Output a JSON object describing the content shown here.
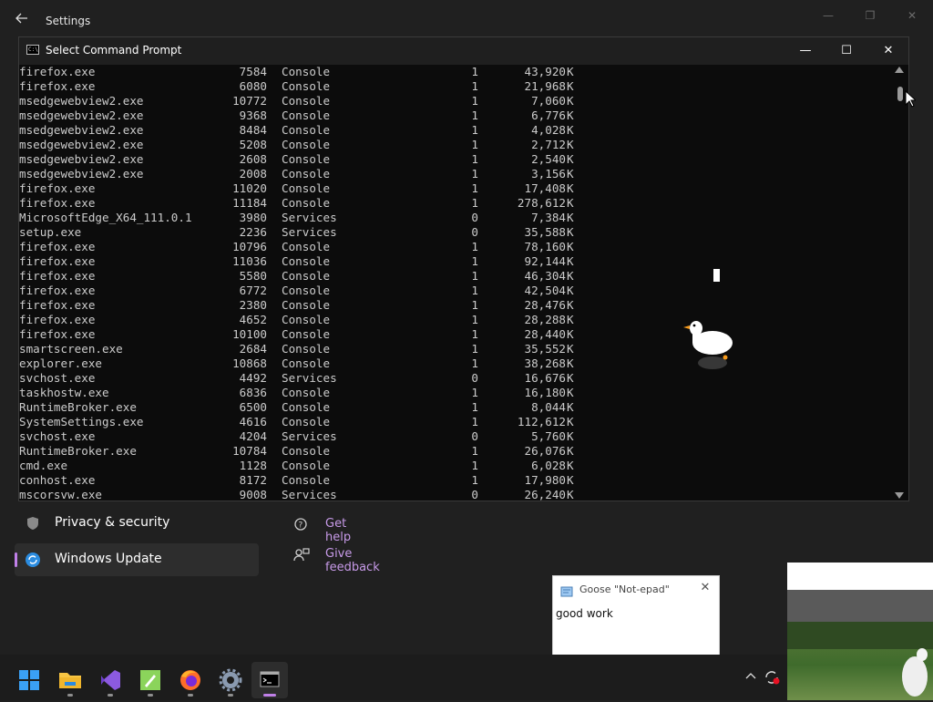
{
  "settings": {
    "title": "Settings",
    "sidebar": [
      {
        "label": "Privacy & security",
        "icon": "shield-icon"
      },
      {
        "label": "Windows Update",
        "icon": "windows-update-icon",
        "active": true
      }
    ],
    "links": [
      {
        "label": "Get help",
        "icon": "help-icon"
      },
      {
        "label": "Give feedback",
        "icon": "feedback-icon"
      }
    ]
  },
  "cmd": {
    "title": "Select Command Prompt",
    "rows": [
      {
        "name": "firefox.exe",
        "pid": "7584",
        "session": "Console",
        "num": "1",
        "mem": "43,920",
        "unit": "K"
      },
      {
        "name": "firefox.exe",
        "pid": "6080",
        "session": "Console",
        "num": "1",
        "mem": "21,968",
        "unit": "K"
      },
      {
        "name": "msedgewebview2.exe",
        "pid": "10772",
        "session": "Console",
        "num": "1",
        "mem": "7,060",
        "unit": "K"
      },
      {
        "name": "msedgewebview2.exe",
        "pid": "9368",
        "session": "Console",
        "num": "1",
        "mem": "6,776",
        "unit": "K"
      },
      {
        "name": "msedgewebview2.exe",
        "pid": "8484",
        "session": "Console",
        "num": "1",
        "mem": "4,028",
        "unit": "K"
      },
      {
        "name": "msedgewebview2.exe",
        "pid": "5208",
        "session": "Console",
        "num": "1",
        "mem": "2,712",
        "unit": "K"
      },
      {
        "name": "msedgewebview2.exe",
        "pid": "2608",
        "session": "Console",
        "num": "1",
        "mem": "2,540",
        "unit": "K"
      },
      {
        "name": "msedgewebview2.exe",
        "pid": "2008",
        "session": "Console",
        "num": "1",
        "mem": "3,156",
        "unit": "K"
      },
      {
        "name": "firefox.exe",
        "pid": "11020",
        "session": "Console",
        "num": "1",
        "mem": "17,408",
        "unit": "K"
      },
      {
        "name": "firefox.exe",
        "pid": "11184",
        "session": "Console",
        "num": "1",
        "mem": "278,612",
        "unit": "K"
      },
      {
        "name": "MicrosoftEdge_X64_111.0.1",
        "pid": "3980",
        "session": "Services",
        "num": "0",
        "mem": "7,384",
        "unit": "K"
      },
      {
        "name": "setup.exe",
        "pid": "2236",
        "session": "Services",
        "num": "0",
        "mem": "35,588",
        "unit": "K"
      },
      {
        "name": "firefox.exe",
        "pid": "10796",
        "session": "Console",
        "num": "1",
        "mem": "78,160",
        "unit": "K"
      },
      {
        "name": "firefox.exe",
        "pid": "11036",
        "session": "Console",
        "num": "1",
        "mem": "92,144",
        "unit": "K"
      },
      {
        "name": "firefox.exe",
        "pid": "5580",
        "session": "Console",
        "num": "1",
        "mem": "46,304",
        "unit": "K"
      },
      {
        "name": "firefox.exe",
        "pid": "6772",
        "session": "Console",
        "num": "1",
        "mem": "42,504",
        "unit": "K"
      },
      {
        "name": "firefox.exe",
        "pid": "2380",
        "session": "Console",
        "num": "1",
        "mem": "28,476",
        "unit": "K"
      },
      {
        "name": "firefox.exe",
        "pid": "4652",
        "session": "Console",
        "num": "1",
        "mem": "28,288",
        "unit": "K"
      },
      {
        "name": "firefox.exe",
        "pid": "10100",
        "session": "Console",
        "num": "1",
        "mem": "28,440",
        "unit": "K"
      },
      {
        "name": "smartscreen.exe",
        "pid": "2684",
        "session": "Console",
        "num": "1",
        "mem": "35,552",
        "unit": "K"
      },
      {
        "name": "explorer.exe",
        "pid": "10868",
        "session": "Console",
        "num": "1",
        "mem": "38,268",
        "unit": "K"
      },
      {
        "name": "svchost.exe",
        "pid": "4492",
        "session": "Services",
        "num": "0",
        "mem": "16,676",
        "unit": "K"
      },
      {
        "name": "taskhostw.exe",
        "pid": "6836",
        "session": "Console",
        "num": "1",
        "mem": "16,180",
        "unit": "K"
      },
      {
        "name": "RuntimeBroker.exe",
        "pid": "6500",
        "session": "Console",
        "num": "1",
        "mem": "8,044",
        "unit": "K"
      },
      {
        "name": "SystemSettings.exe",
        "pid": "4616",
        "session": "Console",
        "num": "1",
        "mem": "112,612",
        "unit": "K"
      },
      {
        "name": "svchost.exe",
        "pid": "4204",
        "session": "Services",
        "num": "0",
        "mem": "5,760",
        "unit": "K"
      },
      {
        "name": "RuntimeBroker.exe",
        "pid": "10784",
        "session": "Console",
        "num": "1",
        "mem": "26,076",
        "unit": "K"
      },
      {
        "name": "cmd.exe",
        "pid": "1128",
        "session": "Console",
        "num": "1",
        "mem": "6,028",
        "unit": "K"
      },
      {
        "name": "conhost.exe",
        "pid": "8172",
        "session": "Console",
        "num": "1",
        "mem": "17,980",
        "unit": "K"
      },
      {
        "name": "mscorsvw.exe",
        "pid": "9008",
        "session": "Services",
        "num": "0",
        "mem": "26,240",
        "unit": "K"
      }
    ]
  },
  "notepad": {
    "title": "Goose \"Not-epad\"",
    "text": "good work"
  },
  "taskbar": {
    "apps": [
      {
        "name": "start-button",
        "icon": "windows-logo-icon"
      },
      {
        "name": "taskbar-file-explorer",
        "icon": "folder-icon"
      },
      {
        "name": "taskbar-visual-studio",
        "icon": "visual-studio-icon"
      },
      {
        "name": "taskbar-notepad-plus",
        "icon": "notepad-icon"
      },
      {
        "name": "taskbar-firefox",
        "icon": "firefox-icon"
      },
      {
        "name": "taskbar-settings",
        "icon": "gear-icon"
      },
      {
        "name": "taskbar-command-prompt",
        "icon": "terminal-icon",
        "active": true
      }
    ]
  },
  "colors": {
    "accent": "#c080e8",
    "console_text": "#cccccc",
    "console_bg": "#0c0c0c"
  }
}
